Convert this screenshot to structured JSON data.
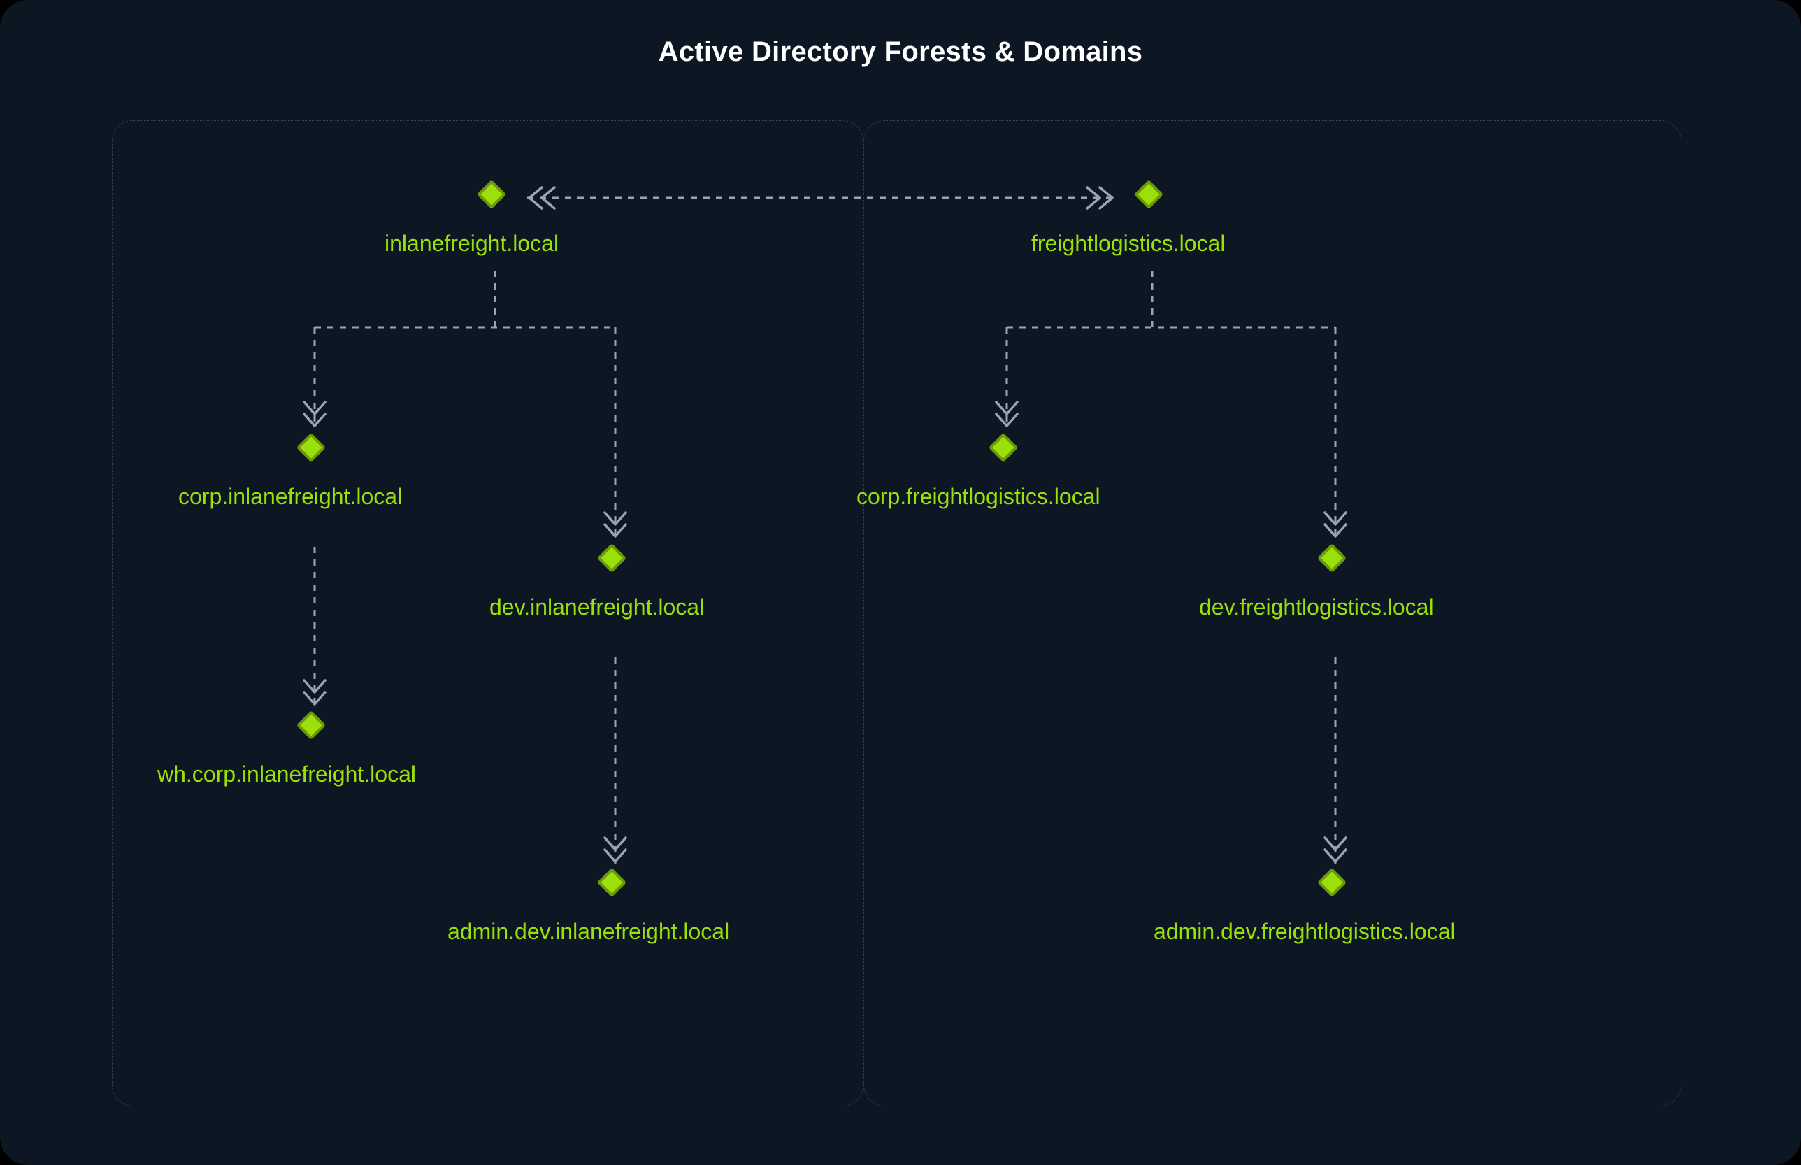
{
  "title": "Active Directory Forests & Domains",
  "colors": {
    "background": "#0d1623",
    "accent": "#9be00b",
    "accent_dark": "#6a9a07",
    "muted_line": "#9aa4b2",
    "white": "#ffffff",
    "dotted_border": "#3a4556"
  },
  "forests": [
    {
      "root": "inlanefreight.local",
      "nodes": {
        "root": "inlanefreight.local",
        "corp": "corp.inlanefreight.local",
        "wh": "wh.corp.inlanefreight.local",
        "dev": "dev.inlanefreight.local",
        "admin_dev": "admin.dev.inlanefreight.local"
      }
    },
    {
      "root": "freightlogistics.local",
      "nodes": {
        "root": "freightlogistics.local",
        "corp": "corp.freightlogistics.local",
        "dev": "dev.freightlogistics.local",
        "admin_dev": "admin.dev.freightlogistics.local"
      }
    }
  ],
  "trust": {
    "type": "bidirectional",
    "between": [
      "inlanefreight.local",
      "freightlogistics.local"
    ]
  }
}
